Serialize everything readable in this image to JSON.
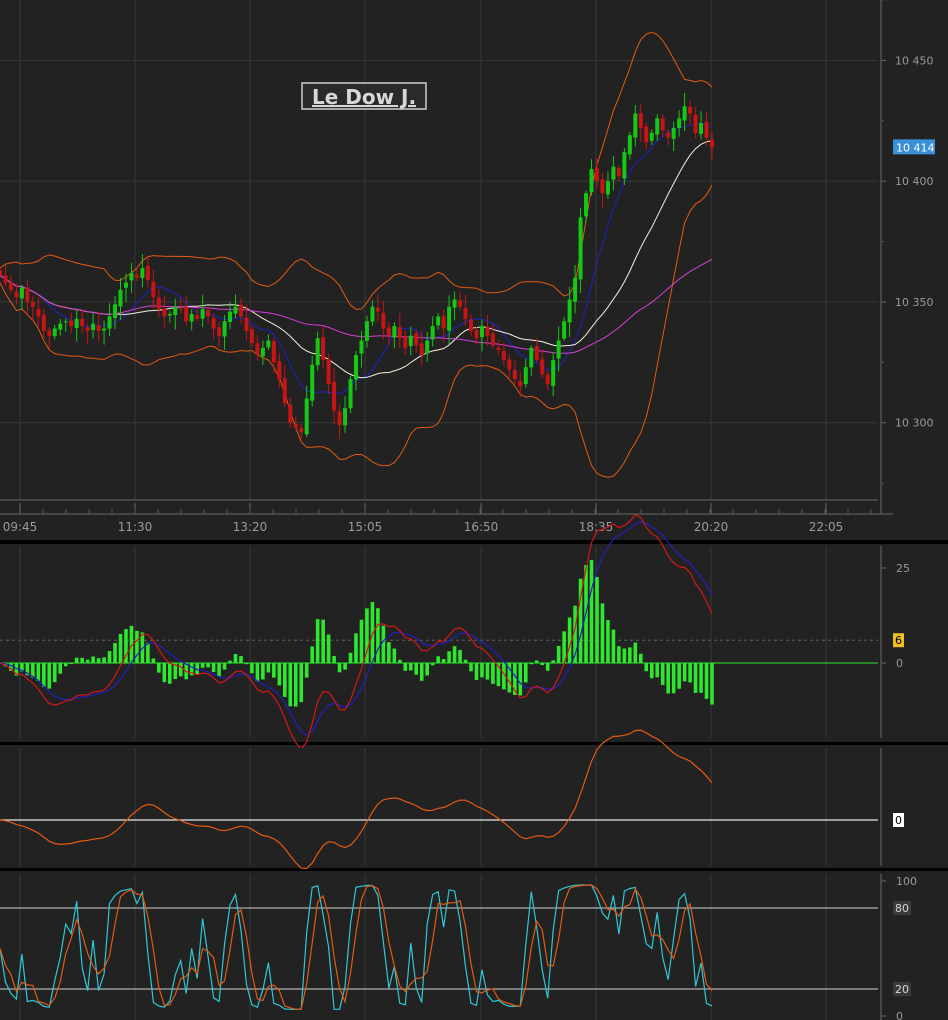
{
  "chart_data": [
    {
      "type": "candlestick",
      "title": "Le Dow J.",
      "x_tick_labels": [
        "09:45",
        "11:30",
        "13:20",
        "15:05",
        "16:50",
        "18:35",
        "20:20",
        "22:05"
      ],
      "y_tick_labels": [
        "10 450",
        "10 400",
        "10 350",
        "10 300"
      ],
      "y_ticks": [
        10450,
        10400,
        10350,
        10300
      ],
      "ylim": [
        10268,
        10475
      ],
      "last_value": 10414,
      "last_value_label": "10 414",
      "grid": true,
      "series_close": [
        10361,
        10358,
        10355,
        10352,
        10356,
        10350,
        10348,
        10344,
        10338,
        10336,
        10339,
        10341,
        10342,
        10340,
        10343,
        10340,
        10338,
        10341,
        10338,
        10339,
        10344,
        10349,
        10355,
        10358,
        10362,
        10360,
        10364,
        10359,
        10352,
        10347,
        10344,
        10345,
        10348,
        10347,
        10342,
        10345,
        10343,
        10347,
        10344,
        10339,
        10336,
        10342,
        10346,
        10348,
        10344,
        10338,
        10333,
        10328,
        10331,
        10334,
        10325,
        10318,
        10308,
        10300,
        10298,
        10296,
        10310,
        10324,
        10335,
        10326,
        10316,
        10305,
        10299,
        10306,
        10318,
        10328,
        10334,
        10342,
        10348,
        10346,
        10339,
        10336,
        10340,
        10335,
        10331,
        10336,
        10332,
        10328,
        10334,
        10340,
        10344,
        10339,
        10348,
        10351,
        10348,
        10343,
        10338,
        10335,
        10340,
        10336,
        10332,
        10330,
        10326,
        10322,
        10318,
        10315,
        10323,
        10331,
        10326,
        10320,
        10316,
        10326,
        10334,
        10342,
        10351,
        10360,
        10385,
        10395,
        10405,
        10400,
        10395,
        10400,
        10406,
        10402,
        10412,
        10419,
        10428,
        10422,
        10416,
        10420,
        10426,
        10421,
        10418,
        10422,
        10426,
        10431,
        10428,
        10420,
        10424,
        10418,
        10414
      ],
      "series_colors": {
        "up": "#14c814",
        "down": "#c81414"
      },
      "overlays": [
        {
          "kind": "bollinger_upper",
          "color": "#e35a12"
        },
        {
          "kind": "bollinger_lower",
          "color": "#e35a12"
        },
        {
          "kind": "ma_short",
          "color": "#1a23c8"
        },
        {
          "kind": "ma_mid",
          "color": "#f5f0dc"
        },
        {
          "kind": "ma_long",
          "color": "#d63fd6"
        }
      ]
    },
    {
      "type": "macd",
      "y_tick_labels": [
        "25",
        "0"
      ],
      "ylim": [
        -30,
        30
      ],
      "signal_level": 6,
      "signal_label": "6",
      "histogram_color": "#2ee82e",
      "line_colors": {
        "macd": "#d21818",
        "signal": "#2020c0"
      }
    },
    {
      "type": "line",
      "y_tick_labels": [
        "0"
      ],
      "ylim": [
        -10,
        22
      ],
      "baseline_label": "0",
      "line_color": "#e35a12"
    },
    {
      "type": "stochastic",
      "y_tick_labels": [
        "100",
        "80",
        "20",
        "0"
      ],
      "levels": [
        80,
        20
      ],
      "ylim": [
        0,
        100
      ],
      "line_colors": {
        "k": "#2ec8d8",
        "d": "#e35a12"
      }
    }
  ]
}
